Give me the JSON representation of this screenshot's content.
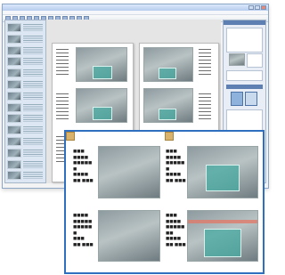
{
  "window": {
    "title": "",
    "menu": [
      "",
      "",
      "",
      "",
      "",
      "",
      ""
    ]
  },
  "zoom_panel": {
    "photo_labels": [
      [
        "■■■",
        "",
        " ■■■■",
        "■■■■■",
        "■",
        "■■■■",
        "■■ ■■■"
      ],
      [
        "■■■",
        "",
        " ■■■■",
        "■■■■■",
        "■",
        "■■■■",
        "■■ ■■■"
      ],
      [
        "■■■■",
        "■■■■■",
        "■■■■■",
        "■",
        "■■■",
        "■■ ■■■"
      ],
      [
        "■■■",
        "■■■■",
        "■■■■■",
        "■■",
        "■■■■",
        "■■ ■■■"
      ]
    ]
  },
  "colors": {
    "accent": "#2f6fc0",
    "window_frame": "#8fa7c6",
    "sign_board": "#46aaa0",
    "marker": "#d9b36c"
  },
  "icons": [
    "minimize-icon",
    "maximize-icon",
    "close-icon",
    "toolbar-tool-icon",
    "marker-square-icon"
  ]
}
